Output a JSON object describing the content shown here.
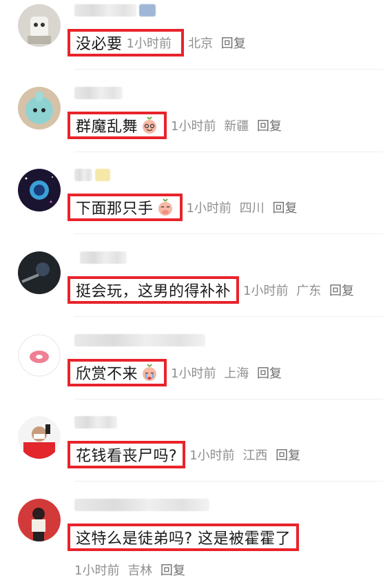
{
  "comments": [
    {
      "text": "没必要",
      "time": "1小时前",
      "location": "北京",
      "reply": "回复",
      "emoji": null
    },
    {
      "text": "群魔乱舞",
      "time": "1小时前",
      "location": "新疆",
      "reply": "回复",
      "emoji": "smile-emoji-icon"
    },
    {
      "text": "下面那只手",
      "time": "1小时前",
      "location": "四川",
      "reply": "回复",
      "emoji": "shy-emoji-icon"
    },
    {
      "text": "挺会玩，这男的得补补",
      "time": "1小时前",
      "location": "广东",
      "reply": "回复",
      "emoji": null
    },
    {
      "text": "欣赏不来",
      "time": "1小时前",
      "location": "上海",
      "reply": "回复",
      "emoji": "cry-emoji-icon"
    },
    {
      "text": "花钱看丧尸吗?",
      "time": "1小时前",
      "location": "江西",
      "reply": "回复",
      "emoji": null
    },
    {
      "text": "这特么是徒弟吗? 这是被霍霍了",
      "time": "1小时前",
      "location": "吉林",
      "reply": "回复",
      "emoji": null
    }
  ],
  "colors": {
    "highlight_box": "#e8232b",
    "meta_text": "#8f8f8f",
    "body_text": "#1a1a1a"
  }
}
